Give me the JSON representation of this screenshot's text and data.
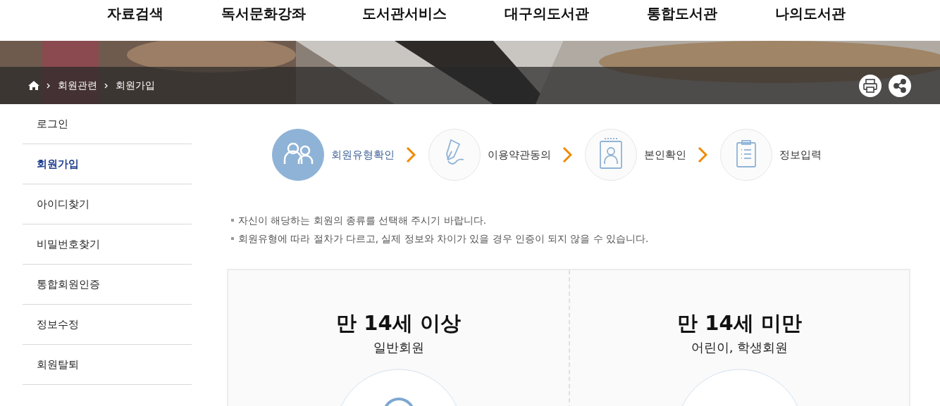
{
  "nav": {
    "items": [
      "자료검색",
      "독서문화강좌",
      "도서관서비스",
      "대구의도서관",
      "통합도서관",
      "나의도서관"
    ]
  },
  "breadcrumb": {
    "items": [
      "회원관련",
      "회원가입"
    ]
  },
  "sidebar": {
    "items": [
      {
        "label": "로그인",
        "selected": false
      },
      {
        "label": "회원가입",
        "selected": true
      },
      {
        "label": "아이디찾기",
        "selected": false
      },
      {
        "label": "비밀번호찾기",
        "selected": false
      },
      {
        "label": "통합회원인증",
        "selected": false
      },
      {
        "label": "정보수정",
        "selected": false
      },
      {
        "label": "회원탈퇴",
        "selected": false
      }
    ]
  },
  "steps": [
    {
      "label": "회원유형확인",
      "kind": "people",
      "selected": true
    },
    {
      "label": "이용약관동의",
      "kind": "pen",
      "selected": false
    },
    {
      "label": "본인확인",
      "kind": "badge",
      "selected": false
    },
    {
      "label": "정보입력",
      "kind": "clipboard",
      "selected": false
    }
  ],
  "notes": [
    "자신이 해당하는 회원의 종류를 선택해 주시기 바랍니다.",
    "회원유형에 따라 절차가 다르고, 실제 정보와 차이가 있을 경우 인증이 되지 않을 수 있습니다."
  ],
  "member_types": [
    {
      "title": "만 14세 이상",
      "subtitle": "일반회원",
      "kind": "adult"
    },
    {
      "title": "만 14세 미만",
      "subtitle": "어린이, 학생회원",
      "kind": "child"
    }
  ]
}
